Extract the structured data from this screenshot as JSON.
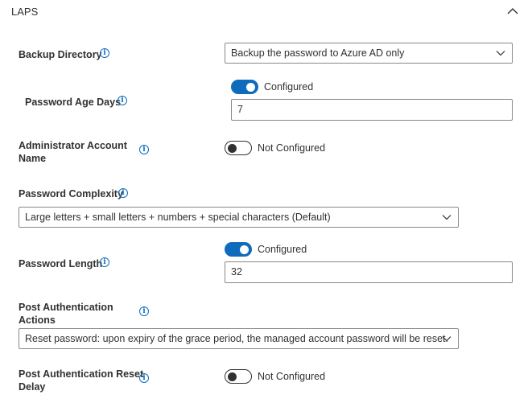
{
  "section": {
    "title": "LAPS",
    "collapse_icon": "chevron-up-icon"
  },
  "backup_directory": {
    "label": "Backup Directory",
    "value": "Backup the password to Azure AD only"
  },
  "password_age_days": {
    "label": "Password Age Days",
    "toggle_state": "on",
    "toggle_label": "Configured",
    "value": "7"
  },
  "administrator_account_name": {
    "label_line1": "Administrator Account",
    "label_line2": "Name",
    "toggle_state": "off",
    "toggle_label": "Not Configured"
  },
  "password_complexity": {
    "label": "Password Complexity",
    "value": "Large letters + small letters + numbers + special characters (Default)"
  },
  "password_length": {
    "label": "Password Length",
    "toggle_state": "on",
    "toggle_label": "Configured",
    "value": "32"
  },
  "post_authentication_actions": {
    "label_line1": "Post Authentication",
    "label_line2": "Actions",
    "value": "Reset password: upon expiry of the grace period, the managed account password will be reset."
  },
  "post_authentication_reset_delay": {
    "label_line1": "Post Authentication Reset",
    "label_line2": "Delay",
    "toggle_state": "off",
    "toggle_label": "Not Configured"
  },
  "icons": {
    "info": "info-icon",
    "dropdown": "chevron-down-icon"
  },
  "colors": {
    "accent": "#0f6cbd",
    "text": "#323130",
    "border": "#8a8886"
  }
}
